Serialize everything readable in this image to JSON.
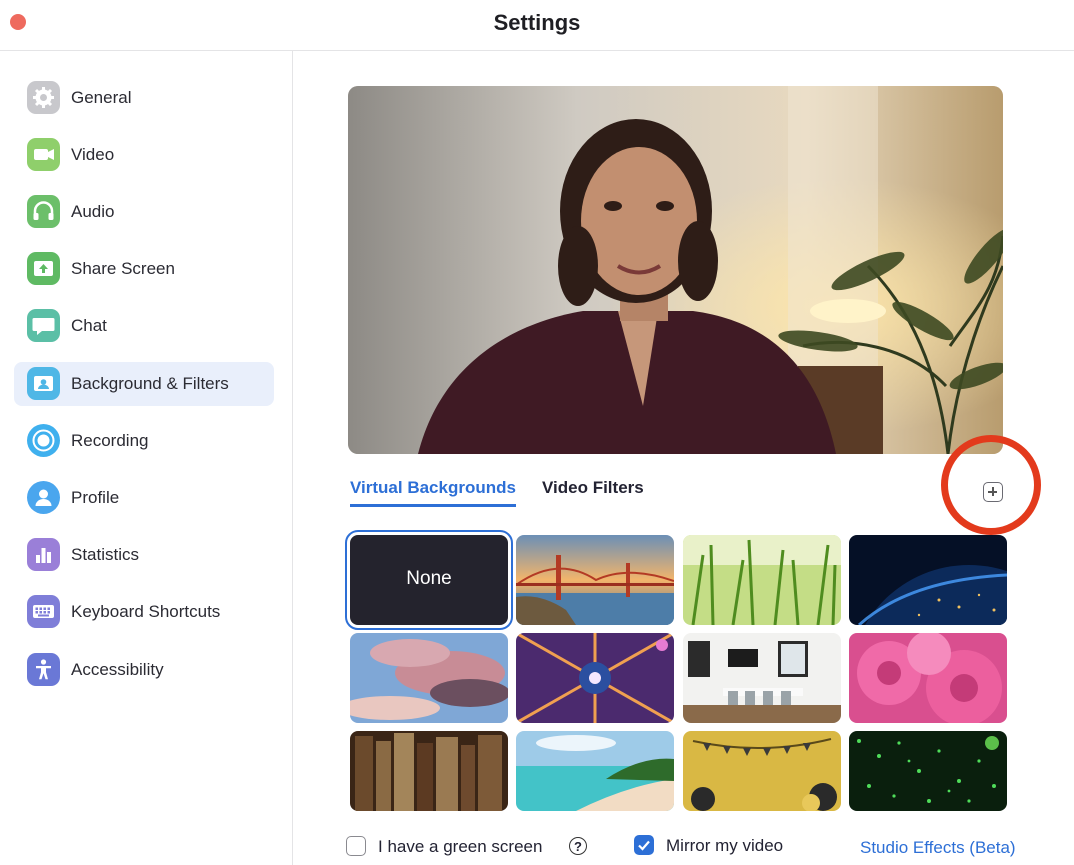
{
  "window": {
    "title": "Settings"
  },
  "sidebar": {
    "items": [
      {
        "label": "General",
        "icon": "gear-icon",
        "color": "#c8c8cc"
      },
      {
        "label": "Video",
        "icon": "video-camera-icon",
        "color": "#8fcf6b"
      },
      {
        "label": "Audio",
        "icon": "headphones-icon",
        "color": "#6cbf6a"
      },
      {
        "label": "Share Screen",
        "icon": "share-screen-icon",
        "color": "#5fba63"
      },
      {
        "label": "Chat",
        "icon": "chat-icon",
        "color": "#5bbfa6"
      },
      {
        "label": "Background & Filters",
        "icon": "background-icon",
        "color": "#4fb7e6"
      },
      {
        "label": "Recording",
        "icon": "record-icon",
        "color": "#3fb0ee"
      },
      {
        "label": "Profile",
        "icon": "profile-icon",
        "color": "#4aa6ee"
      },
      {
        "label": "Statistics",
        "icon": "statistics-icon",
        "color": "#9a7fd8"
      },
      {
        "label": "Keyboard Shortcuts",
        "icon": "keyboard-icon",
        "color": "#7f7ed8"
      },
      {
        "label": "Accessibility",
        "icon": "accessibility-icon",
        "color": "#6a78d6"
      }
    ],
    "active": "Background & Filters"
  },
  "tabs": {
    "virtual_backgrounds": "Virtual Backgrounds",
    "video_filters": "Video Filters"
  },
  "backgrounds": {
    "none_label": "None",
    "items": [
      "none",
      "golden-gate-bridge",
      "grass",
      "earth-from-space",
      "pink-clouds",
      "kaleidoscope",
      "conference-room",
      "pink-flowers",
      "old-books",
      "tropical-beach",
      "gold-party",
      "green-sparkles"
    ]
  },
  "footer": {
    "green_screen_label": "I have a green screen",
    "green_screen_checked": false,
    "help_glyph": "?",
    "mirror_label": "Mirror my video",
    "mirror_checked": true,
    "studio_effects": "Studio Effects (Beta)"
  },
  "colors": {
    "accent": "#2d6fd6",
    "annotation": "#e33a1c"
  }
}
